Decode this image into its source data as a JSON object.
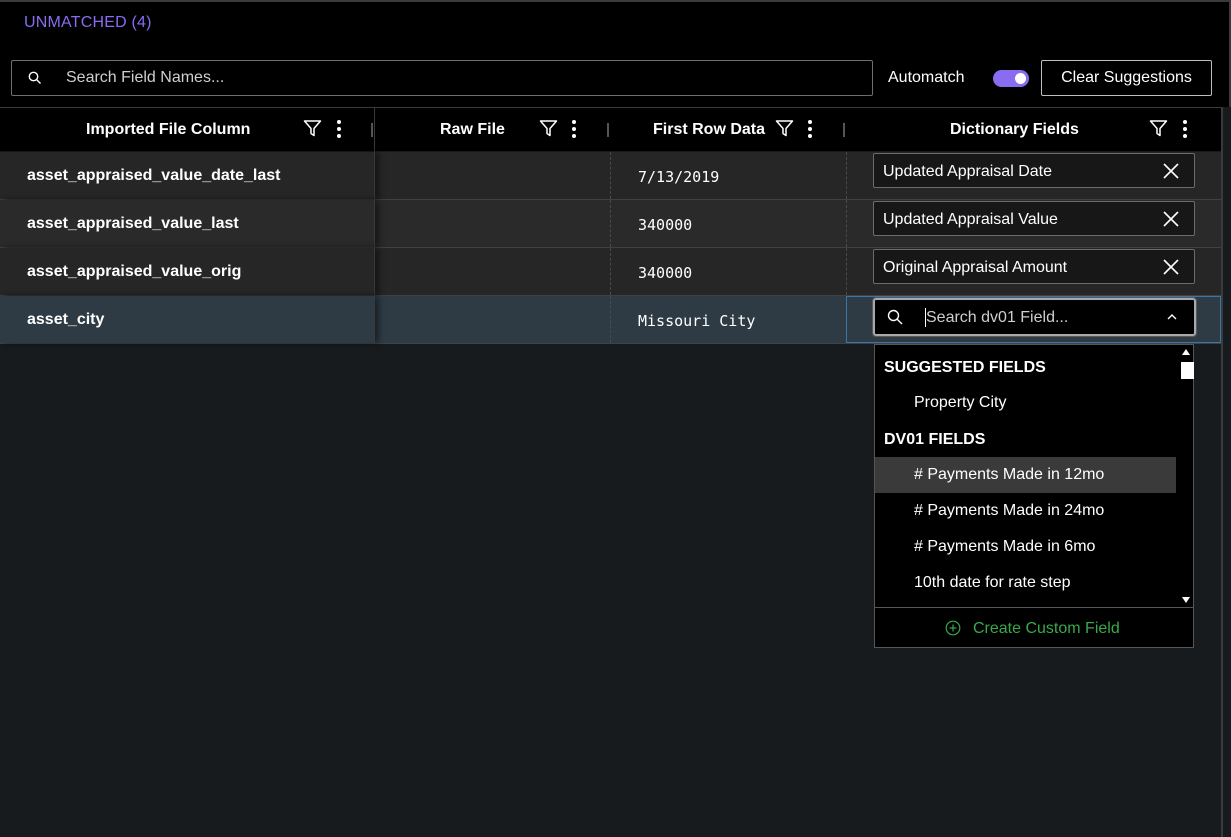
{
  "section": {
    "title": "UNMATCHED (4)"
  },
  "toolbar": {
    "search_placeholder": "Search Field Names...",
    "automatch_label": "Automatch",
    "automatch_on": true,
    "clear_label": "Clear Suggestions"
  },
  "columns": [
    {
      "label": "Imported File Column"
    },
    {
      "label": "Raw File"
    },
    {
      "label": "First Row Data"
    },
    {
      "label": "Dictionary Fields"
    }
  ],
  "rows": [
    {
      "column": "asset_appraised_value_date_last",
      "first_row": "7/13/2019",
      "dictionary": "Updated Appraisal Date"
    },
    {
      "column": "asset_appraised_value_last",
      "first_row": "340000",
      "dictionary": "Updated Appraisal Value"
    },
    {
      "column": "asset_appraised_value_orig",
      "first_row": "340000",
      "dictionary": "Original Appraisal Amount"
    },
    {
      "column": "asset_city",
      "first_row": "Missouri City",
      "dictionary": ""
    }
  ],
  "dropdown": {
    "placeholder": "Search dv01 Field...",
    "suggested_header": "SUGGESTED FIELDS",
    "suggested": [
      "Property City"
    ],
    "fields_header": "DV01 FIELDS",
    "fields": [
      "# Payments Made in 12mo",
      "# Payments Made in 24mo",
      "# Payments Made in 6mo",
      "10th date for rate step"
    ],
    "create_label": "Create Custom Field"
  },
  "colors": {
    "accent": "#8a6cf0",
    "create": "#3aa84a",
    "selection": "#3a77a8"
  }
}
